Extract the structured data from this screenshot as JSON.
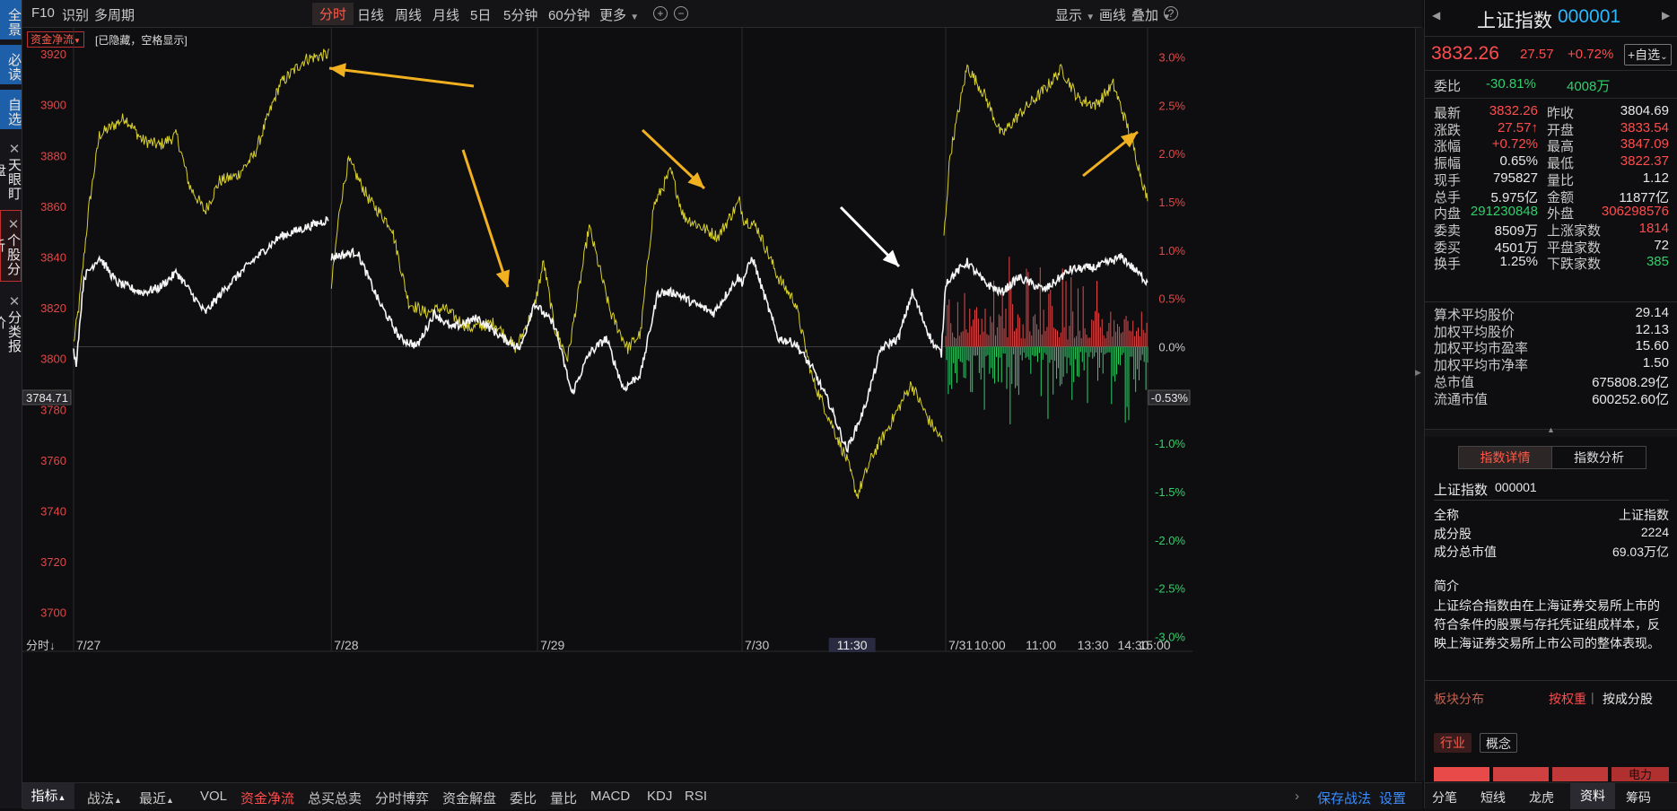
{
  "left_strip": {
    "items": [
      {
        "label": "全景"
      },
      {
        "label": "必读"
      },
      {
        "label": "自选"
      },
      {
        "label": "天眼盯盘"
      },
      {
        "label": "个股分析"
      },
      {
        "label": "分类报价"
      }
    ]
  },
  "topbar": {
    "left_items": [
      "F10",
      "识别",
      "多周期"
    ],
    "tabs": [
      "分时",
      "日线",
      "周线",
      "月线",
      "5日",
      "5分钟",
      "60分钟",
      "更多"
    ],
    "active_tab": "分时",
    "right_items": [
      "显示",
      "画线",
      "叠加"
    ],
    "help": "?"
  },
  "chart_header": {
    "indicator_select": "资金净流",
    "hidden_note": "[已隐藏，空格显示]"
  },
  "chart_data": {
    "type": "line",
    "x_labels": [
      "7/27",
      "7/28",
      "7/29",
      "7/30",
      "7/31",
      "10:00",
      "11:00",
      "13:30",
      "14:30",
      "15:00"
    ],
    "cursor_x_label": "11:30",
    "y_left_ticks": [
      "3920",
      "3900",
      "3880",
      "3860",
      "3840",
      "3820",
      "3800",
      "3780",
      "3760",
      "3740",
      "3720",
      "3700"
    ],
    "y_right_ticks": [
      "3.0%",
      "2.5%",
      "2.0%",
      "1.5%",
      "1.0%",
      "0.5%",
      "0.0%",
      "-1.0%",
      "-1.5%",
      "-2.0%",
      "-2.5%",
      "-3.0%"
    ],
    "cursor_price_label": "3784.71",
    "cursor_pct_label": "-0.53%",
    "ylim": [
      3690,
      3925
    ],
    "series": [
      {
        "color": "#ffffff"
      },
      {
        "color": "#d8d02c"
      }
    ],
    "white_keys": [
      [
        0,
        3803
      ],
      [
        3,
        3798
      ],
      [
        12,
        3832
      ],
      [
        30,
        3840
      ],
      [
        50,
        3830
      ],
      [
        80,
        3826
      ],
      [
        100,
        3828
      ],
      [
        120,
        3834
      ],
      [
        153,
        3818
      ],
      [
        180,
        3829
      ],
      [
        210,
        3839
      ],
      [
        240,
        3848
      ],
      [
        298,
        3855
      ],
      [
        300,
        3840
      ],
      [
        330,
        3842
      ],
      [
        356,
        3822
      ],
      [
        380,
        3808
      ],
      [
        400,
        3805
      ],
      [
        420,
        3818
      ],
      [
        440,
        3812
      ],
      [
        470,
        3816
      ],
      [
        500,
        3808
      ],
      [
        520,
        3804
      ],
      [
        536,
        3822
      ],
      [
        560,
        3813
      ],
      [
        580,
        3786
      ],
      [
        600,
        3802
      ],
      [
        620,
        3808
      ],
      [
        640,
        3788
      ],
      [
        660,
        3794
      ],
      [
        680,
        3826
      ],
      [
        700,
        3826
      ],
      [
        720,
        3822
      ],
      [
        745,
        3818
      ],
      [
        773,
        3832
      ],
      [
        778,
        3830
      ],
      [
        790,
        3840
      ],
      [
        800,
        3829
      ],
      [
        820,
        3808
      ],
      [
        840,
        3806
      ],
      [
        860,
        3796
      ],
      [
        880,
        3782
      ],
      [
        900,
        3764
      ],
      [
        920,
        3780
      ],
      [
        940,
        3804
      ],
      [
        960,
        3808
      ],
      [
        976,
        3826
      ],
      [
        1000,
        3806
      ],
      [
        1010,
        3802
      ],
      [
        1015,
        3830
      ],
      [
        1040,
        3838
      ],
      [
        1060,
        3830
      ],
      [
        1080,
        3826
      ],
      [
        1100,
        3832
      ],
      [
        1130,
        3827
      ],
      [
        1160,
        3835
      ],
      [
        1190,
        3836
      ],
      [
        1220,
        3840
      ],
      [
        1250,
        3830
      ]
    ],
    "yellow_keys": [
      [
        0,
        3806
      ],
      [
        6,
        3820
      ],
      [
        18,
        3860
      ],
      [
        30,
        3888
      ],
      [
        60,
        3895
      ],
      [
        80,
        3886
      ],
      [
        100,
        3884
      ],
      [
        120,
        3888
      ],
      [
        135,
        3868
      ],
      [
        153,
        3858
      ],
      [
        170,
        3870
      ],
      [
        190,
        3872
      ],
      [
        210,
        3880
      ],
      [
        240,
        3908
      ],
      [
        270,
        3918
      ],
      [
        298,
        3920
      ],
      [
        300,
        3828
      ],
      [
        310,
        3860
      ],
      [
        320,
        3878
      ],
      [
        345,
        3862
      ],
      [
        370,
        3852
      ],
      [
        390,
        3822
      ],
      [
        410,
        3818
      ],
      [
        430,
        3820
      ],
      [
        460,
        3812
      ],
      [
        490,
        3814
      ],
      [
        515,
        3804
      ],
      [
        536,
        3820
      ],
      [
        547,
        3838
      ],
      [
        560,
        3812
      ],
      [
        575,
        3800
      ],
      [
        600,
        3852
      ],
      [
        625,
        3818
      ],
      [
        645,
        3804
      ],
      [
        660,
        3810
      ],
      [
        675,
        3860
      ],
      [
        695,
        3874
      ],
      [
        710,
        3856
      ],
      [
        730,
        3852
      ],
      [
        750,
        3848
      ],
      [
        775,
        3862
      ],
      [
        780,
        3855
      ],
      [
        795,
        3852
      ],
      [
        820,
        3832
      ],
      [
        840,
        3822
      ],
      [
        860,
        3792
      ],
      [
        880,
        3776
      ],
      [
        900,
        3760
      ],
      [
        912,
        3746
      ],
      [
        930,
        3762
      ],
      [
        950,
        3774
      ],
      [
        975,
        3790
      ],
      [
        995,
        3776
      ],
      [
        1012,
        3767
      ],
      [
        1013,
        3848
      ],
      [
        1020,
        3880
      ],
      [
        1040,
        3915
      ],
      [
        1060,
        3904
      ],
      [
        1080,
        3888
      ],
      [
        1100,
        3896
      ],
      [
        1130,
        3906
      ],
      [
        1150,
        3914
      ],
      [
        1170,
        3902
      ],
      [
        1190,
        3900
      ],
      [
        1210,
        3908
      ],
      [
        1230,
        3888
      ],
      [
        1250,
        3862
      ]
    ]
  },
  "bottombar": {
    "left_tabs": [
      "指标",
      "战法",
      "最近"
    ],
    "indicators": [
      "VOL",
      "资金净流",
      "总买总卖",
      "分时博弈",
      "资金解盘",
      "委比",
      "量比",
      "MACD",
      "KDJ",
      "RSI"
    ],
    "active_indicator": "资金净流",
    "right_links": [
      "保存战法",
      "设置"
    ]
  },
  "right_panel": {
    "title": "上证指数",
    "code": "000001",
    "price": "3832.26",
    "change": "27.57",
    "change_pct": "+0.72%",
    "add_fav": "+自选",
    "weibi": {
      "label": "委比",
      "value": "-30.81%",
      "vol": "4008万"
    },
    "stats": [
      {
        "l1": "最新",
        "v1": "3832.26",
        "c1": "red",
        "l2": "昨收",
        "v2": "3804.69",
        "c2": "white"
      },
      {
        "l1": "涨跌",
        "v1": "27.57↑",
        "c1": "red",
        "l2": "开盘",
        "v2": "3833.54",
        "c2": "red"
      },
      {
        "l1": "涨幅",
        "v1": "+0.72%",
        "c1": "red",
        "l2": "最高",
        "v2": "3847.09",
        "c2": "red"
      },
      {
        "l1": "振幅",
        "v1": "0.65%",
        "c1": "white",
        "l2": "最低",
        "v2": "3822.37",
        "c2": "red"
      },
      {
        "l1": "现手",
        "v1": "795827",
        "c1": "white",
        "l2": "量比",
        "v2": "1.12",
        "c2": "white"
      },
      {
        "l1": "总手",
        "v1": "5.975亿",
        "c1": "white",
        "l2": "金额",
        "v2": "11877亿",
        "c2": "white"
      },
      {
        "l1": "内盘",
        "v1": "291230848",
        "c1": "green",
        "l2": "外盘",
        "v2": "306298576",
        "c2": "red"
      },
      {
        "l1": "委卖",
        "v1": "8509万",
        "c1": "white",
        "l2": "上涨家数",
        "v2": "1814",
        "c2": "red"
      },
      {
        "l1": "委买",
        "v1": "4501万",
        "c1": "white",
        "l2": "平盘家数",
        "v2": "72",
        "c2": "white"
      },
      {
        "l1": "换手",
        "v1": "1.25%",
        "c1": "white",
        "l2": "下跌家数",
        "v2": "385",
        "c2": "green"
      }
    ],
    "metrics": [
      {
        "label": "算术平均股价",
        "value": "29.14"
      },
      {
        "label": "加权平均股价",
        "value": "12.13"
      },
      {
        "label": "加权平均市盈率",
        "value": "15.60"
      },
      {
        "label": "加权平均市净率",
        "value": "1.50"
      },
      {
        "label": "总市值",
        "value": "675808.29亿"
      },
      {
        "label": "流通市值",
        "value": "600252.60亿"
      }
    ],
    "detail_tabs": [
      "指数详情",
      "指数分析"
    ],
    "detail_name": "上证指数",
    "detail_code": "000001",
    "detail_rows": [
      {
        "label": "全称",
        "value": "上证指数"
      },
      {
        "label": "成分股",
        "value": "2224"
      },
      {
        "label": "成分总市值",
        "value": "69.03万亿"
      }
    ],
    "intro_label": "简介",
    "intro_text": "上证综合指数由在上海证券交易所上市的符合条件的股票与存托凭证组成样本，反映上海证券交易所上市公司的整体表现。",
    "sector_label": "板块分布",
    "sector_sort": [
      "按权重",
      "按成分股"
    ],
    "sector_tabs": [
      "行业",
      "概念"
    ],
    "sector_bar_label": "电力",
    "bottom_tabs": [
      "分笔",
      "短线",
      "龙虎",
      "资料",
      "筹码"
    ],
    "active_bottom_tab": "资料"
  }
}
